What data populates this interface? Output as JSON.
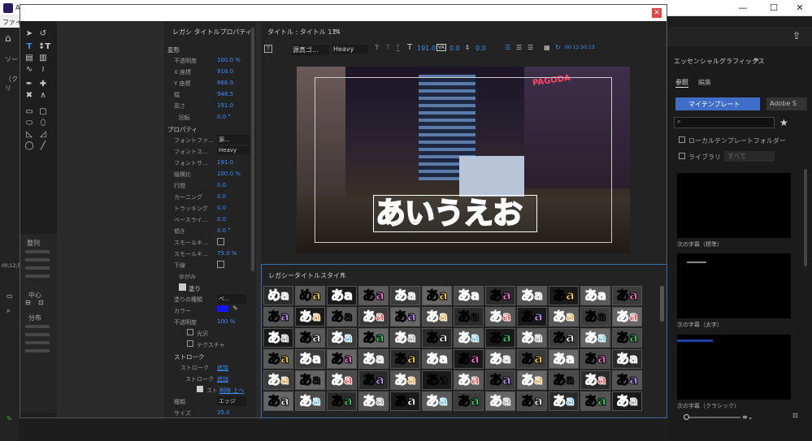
{
  "app": {
    "title": "Ad",
    "menu": "ファイル",
    "window_buttons": [
      "—",
      "☐",
      "✕"
    ]
  },
  "tools": {
    "items": [
      "select-arrow",
      "rotate",
      "type",
      "vertical-type",
      "area-type",
      "vertical-area-type",
      "path-type",
      "vertical-path-type",
      "pen",
      "add-anchor",
      "delete-anchor",
      "convert-anchor",
      "rectangle",
      "rounded-rect",
      "clipped-rect",
      "rounded-corner",
      "ellipse",
      "line",
      "wedge",
      "arc"
    ]
  },
  "align_labels": {
    "align": "整列",
    "center": "中心",
    "distribute": "分布"
  },
  "props": {
    "tab": "レガシ タイトルプロパティ",
    "sections": {
      "transform": "変形",
      "properties": "プロパティ",
      "fill": "塗り",
      "stroke": "ストローク"
    },
    "rows": [
      {
        "label": "不透明度",
        "value": "100.0 %"
      },
      {
        "label": "X 座標",
        "value": "916.0"
      },
      {
        "label": "Y 座標",
        "value": "868.9"
      },
      {
        "label": "幅",
        "value": "948.5"
      },
      {
        "label": "高さ",
        "value": "191.0"
      },
      {
        "label": "回転",
        "value": "0.0 °"
      }
    ],
    "prop_rows": [
      {
        "label": "フォントファ...",
        "value": "源..."
      },
      {
        "label": "フォントス...",
        "value": "Heavy"
      },
      {
        "label": "フォントサ...",
        "value": "191.0"
      },
      {
        "label": "縦横比",
        "value": "100.0 %"
      },
      {
        "label": "行間",
        "value": "0.0"
      },
      {
        "label": "カーニング",
        "value": "0.0"
      },
      {
        "label": "トラッキング",
        "value": "0.0"
      },
      {
        "label": "ベースライ...",
        "value": "0.0"
      },
      {
        "label": "傾き",
        "value": "0.0 °"
      },
      {
        "label": "スモールキ...",
        "value": ""
      },
      {
        "label": "スモールキ...",
        "value": "75.0 %"
      },
      {
        "label": "下線",
        "value": ""
      },
      {
        "label": "ゆがみ",
        "value": ""
      }
    ],
    "fill_rows": [
      {
        "label": "塗りの種類",
        "value": "べ..."
      },
      {
        "label": "カラー",
        "value": ""
      },
      {
        "label": "不透明度",
        "value": "100 %"
      },
      {
        "label": "光沢",
        "value": ""
      },
      {
        "label": "テクスチャ",
        "value": ""
      }
    ],
    "stroke_rows": [
      {
        "label": "ストローク",
        "value": "追加"
      },
      {
        "label": "ストローク",
        "value": "追加"
      },
      {
        "label": "スト",
        "value": "削除 上へ"
      },
      {
        "label": "種類",
        "value": "エッジ"
      },
      {
        "label": "サイズ",
        "value": "35.0"
      }
    ]
  },
  "title_panel": {
    "header": "タイトル : タイトル 114",
    "font": "源真ゴ...",
    "weight": "Heavy",
    "size": "191.0",
    "kerning": "0.0",
    "leading": "0.0",
    "timecode": "00:12:50:13",
    "preview_text": "あいうえお",
    "sign_text": "PAGODA"
  },
  "styles": {
    "header": "レガシータイトルスタイル",
    "sample": "あa",
    "sample_alt": "めa"
  },
  "essential": {
    "header": "エッセンシャルグラフィックス",
    "tabs": [
      "参照",
      "編集"
    ],
    "mytemplates": "マイテンプレート",
    "adobe": "Adobe S",
    "local_folder": "ローカルテンプレートフォルダー",
    "library": "ライブラリ",
    "library_select": "すべて",
    "templates": [
      "次の字幕（標準）",
      "次の字幕（太字）",
      "次の字幕（クラシック）"
    ]
  },
  "left_panel": {
    "src": "ソー",
    "clip": "（クリ",
    "time": "00;12;5"
  },
  "colors": {
    "accent": "#3e8ef7",
    "fill_color": "#1414ff"
  }
}
